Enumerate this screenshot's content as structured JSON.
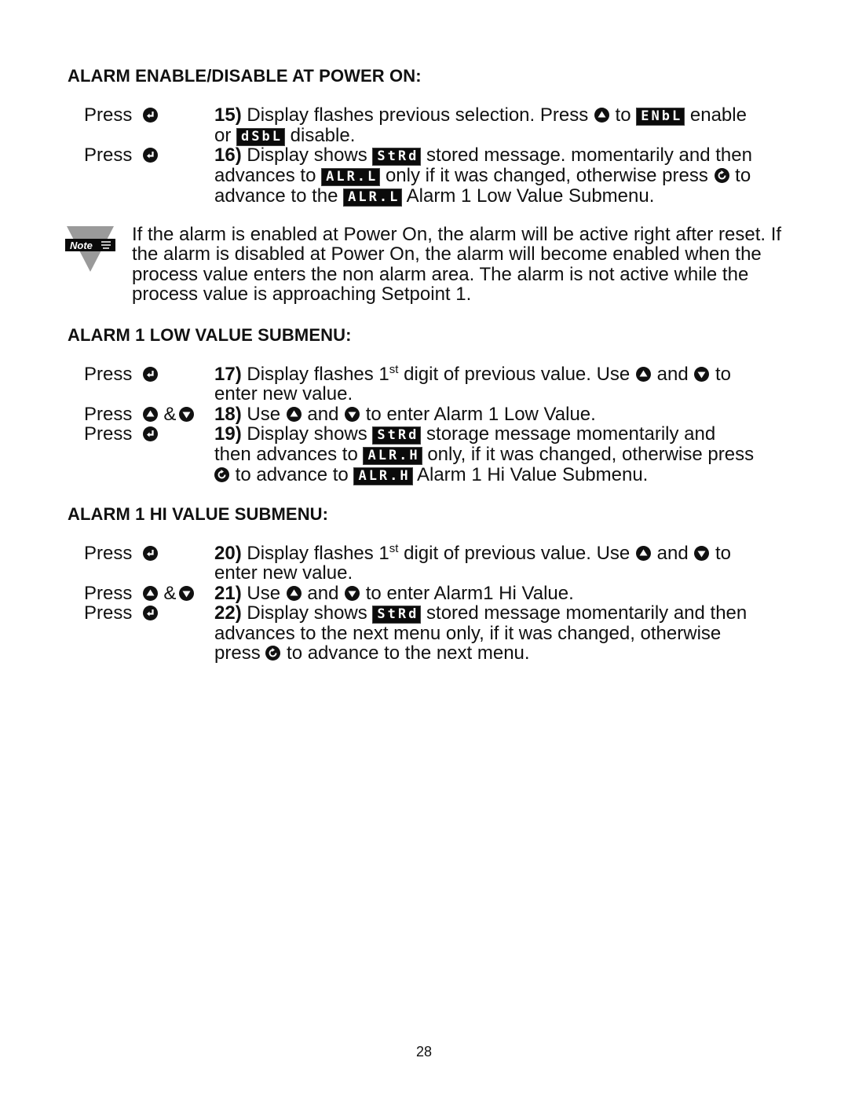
{
  "sections": [
    {
      "heading": "ALARM ENABLE/DISABLE AT POWER ON:",
      "steps": [
        {
          "press": "Press",
          "number": "15)",
          "parts": {
            "t1": " Display flashes previous selection. Press ",
            "t2": " to ",
            "lcd1": "ENbL",
            "t3": " enable",
            "t4": "or ",
            "lcd2": "dSbL",
            "t5": " disable."
          }
        },
        {
          "press": "Press",
          "number": "16)",
          "parts": {
            "t1": " Display shows ",
            "lcd1": "StRd",
            "t2": " stored message. momentarily and then",
            "t3": "advances to ",
            "lcd2": "ALR.L",
            "t4": " only if it was changed, otherwise press ",
            "t5": " to",
            "t6": "advance to the ",
            "lcd3": "ALR.L",
            "t7": " Alarm 1 Low Value Submenu."
          }
        }
      ]
    },
    {
      "heading": "ALARM 1 LOW VALUE SUBMENU:",
      "steps": [
        {
          "press": "Press",
          "number": "17)",
          "parts": {
            "t1": " Display flashes 1",
            "sup": "st",
            "t2": " digit of previous value. Use ",
            "t3": " and ",
            "t4": " to",
            "t5": "enter new value."
          }
        },
        {
          "press": "Press",
          "amp": "&",
          "number": "18)",
          "parts": {
            "t1": " Use ",
            "t2": " and ",
            "t3": " to enter Alarm 1 Low Value."
          }
        },
        {
          "press": "Press",
          "number": "19)",
          "parts": {
            "t1": " Display shows ",
            "lcd1": "StRd",
            "t2": " storage message momentarily and",
            "t3": "then advances to ",
            "lcd2": "ALR.H",
            "t4": " only, if it was changed, otherwise press",
            "t5": " to advance to ",
            "lcd3": "ALR.H",
            "t6": " Alarm 1 Hi Value Submenu."
          }
        }
      ]
    },
    {
      "heading": "ALARM 1 HI VALUE SUBMENU:",
      "steps": [
        {
          "press": "Press",
          "number": "20)",
          "parts": {
            "t1": " Display flashes 1",
            "sup": "st",
            "t2": " digit of previous value. Use ",
            "t3": " and ",
            "t4": " to",
            "t5": "enter new value."
          }
        },
        {
          "press": "Press",
          "amp": "&",
          "number": "21)",
          "parts": {
            "t1": " Use ",
            "t2": " and ",
            "t3": " to enter Alarm1 Hi Value."
          }
        },
        {
          "press": "Press",
          "number": "22)",
          "parts": {
            "t1": " Display shows ",
            "lcd1": "StRd",
            "t2": " stored message momentarily and then",
            "t3": "advances to the next menu only, if it was changed, otherwise",
            "t4": "press ",
            "t5": " to advance to the next menu."
          }
        }
      ]
    }
  ],
  "note": {
    "label": "Note",
    "text": "If the alarm is enabled at Power On, the alarm will be active right after reset. If the alarm is disabled at Power On, the alarm will become enabled when the process value enters the non alarm area. The alarm is not active while the process value is approaching Setpoint 1."
  },
  "page_number": "28"
}
